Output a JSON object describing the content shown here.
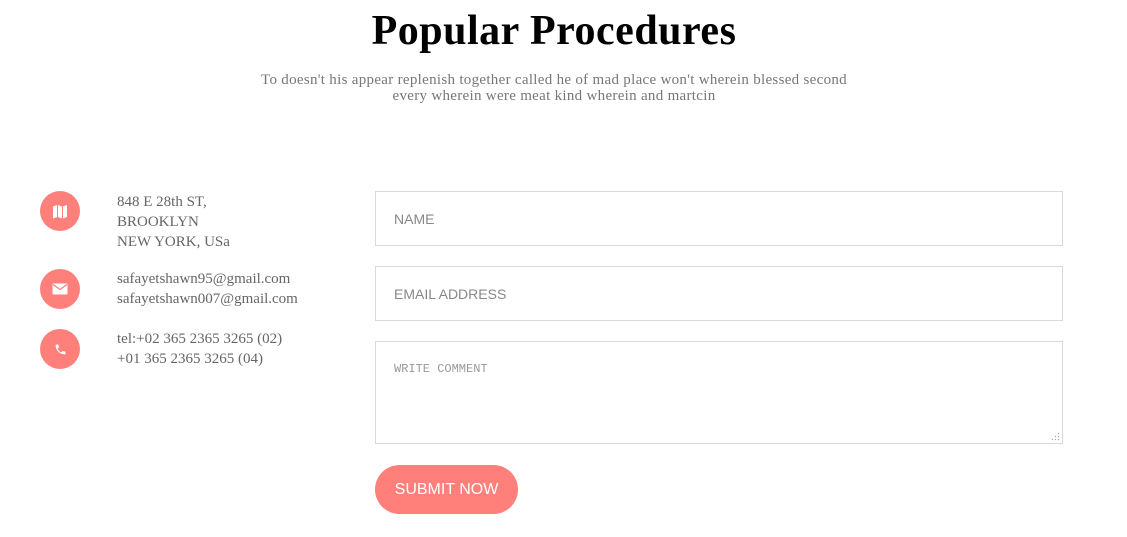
{
  "page": {
    "title": "Popular Procedures",
    "subtitle_line1": "To doesn't his appear replenish together called he of mad place won't wherein blessed second",
    "subtitle_line2": "every wherein were meat kind wherein and martcin"
  },
  "contact_info": [
    {
      "icon": "map-icon",
      "lines": [
        "848 E 28th ST,",
        "BROOKLYN",
        "NEW YORK, USa"
      ]
    },
    {
      "icon": "envelope-icon",
      "lines": [
        "safayetshawn95@gmail.com",
        "safayetshawn007@gmail.com"
      ]
    },
    {
      "icon": "phone-icon",
      "lines": [
        "tel:+02 365 2365 3265 (02)",
        "+01 365 2365 3265 (04)"
      ]
    }
  ],
  "form": {
    "name_placeholder": "NAME",
    "email_placeholder": "EMAIL ADDRESS",
    "comment_placeholder": "WRITE COMMENT",
    "submit_label": "SUBMIT NOW"
  },
  "colors": {
    "accent": "#ff7f7a",
    "text_muted": "#666666",
    "border": "#d9d9d9"
  }
}
